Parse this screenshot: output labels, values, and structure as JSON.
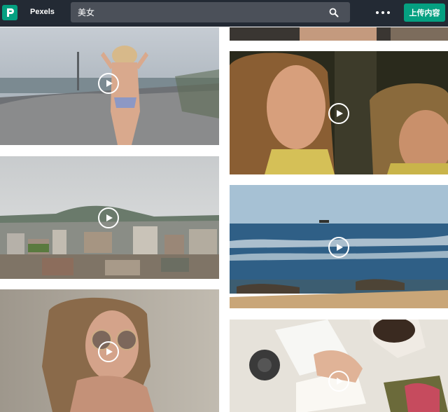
{
  "header": {
    "brand": "Pexels",
    "search_value": "美女",
    "upload_label": "上传内容",
    "accent_color": "#05a081",
    "background_color": "#232a34"
  },
  "icons": {
    "logo": "pexels-logo-icon",
    "search": "search-icon",
    "more": "more-dots-icon",
    "play": "play-circle-icon"
  },
  "videos": [
    {
      "scene": "woman-on-beach-road"
    },
    {
      "scene": "city-skyline-mountain"
    },
    {
      "scene": "woman-with-round-sunglasses"
    },
    {
      "scene": "top-crop"
    },
    {
      "scene": "two-women-sunset"
    },
    {
      "scene": "ocean-rocks-boat"
    },
    {
      "scene": "desk-writing-overhead"
    }
  ]
}
